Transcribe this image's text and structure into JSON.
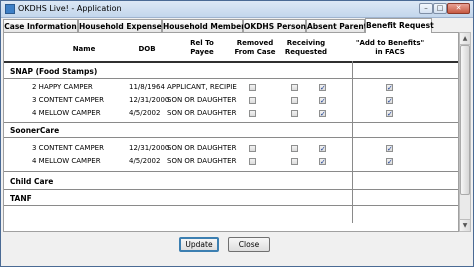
{
  "window": {
    "title": "OKDHS Live! - Application",
    "min_icon": "minimize-icon",
    "max_icon": "maximize-icon",
    "close_icon": "close-icon",
    "min_glyph": "–",
    "max_glyph": "□",
    "close_glyph": "✕"
  },
  "tabs": [
    {
      "label": "Case Information"
    },
    {
      "label": "Household Expenses"
    },
    {
      "label": "Household Members"
    },
    {
      "label": "OKDHS Person"
    },
    {
      "label": "Absent Parent"
    },
    {
      "label": "Benefit Request",
      "active": true
    }
  ],
  "table": {
    "headers": {
      "name": "Name",
      "dob": "DOB",
      "rel_to_payee": "Rel To Payee",
      "removed_from_case": "Removed From Case",
      "receiving_requested": "Receiving Requested",
      "add_to_benefits": "\"Add to Benefits\" in FACS"
    },
    "sections": [
      {
        "title": "SNAP (Food Stamps)",
        "rows": [
          {
            "name": "2 HAPPY CAMPER",
            "dob": "11/8/1964",
            "rel": "APPLICANT, RECIPIE",
            "removed": false,
            "receiving": false,
            "requested": true,
            "add_to_benefits": true
          },
          {
            "name": "3 CONTENT CAMPER",
            "dob": "12/31/2000",
            "rel": "SON OR DAUGHTER",
            "removed": false,
            "receiving": false,
            "requested": true,
            "add_to_benefits": true
          },
          {
            "name": "4 MELLOW CAMPER",
            "dob": "4/5/2002",
            "rel": "SON OR DAUGHTER",
            "removed": false,
            "receiving": false,
            "requested": true,
            "add_to_benefits": true
          }
        ]
      },
      {
        "title": "SoonerCare",
        "rows": [
          {
            "name": "3 CONTENT CAMPER",
            "dob": "12/31/2000",
            "rel": "SON OR DAUGHTER",
            "removed": false,
            "receiving": false,
            "requested": true,
            "add_to_benefits": true
          },
          {
            "name": "4 MELLOW CAMPER",
            "dob": "4/5/2002",
            "rel": "SON OR DAUGHTER",
            "removed": false,
            "receiving": false,
            "requested": true,
            "add_to_benefits": true
          }
        ]
      },
      {
        "title": "Child Care",
        "rows": []
      },
      {
        "title": "TANF",
        "rows": []
      }
    ]
  },
  "buttons": {
    "update": "Update",
    "close": "Close"
  },
  "scrollbar": {
    "up_icon": "scroll-up-arrow-icon",
    "down_icon": "scroll-down-arrow-icon",
    "up_glyph": "▲",
    "down_glyph": "▼"
  },
  "checkbox": {
    "checked_glyph": "✓"
  }
}
